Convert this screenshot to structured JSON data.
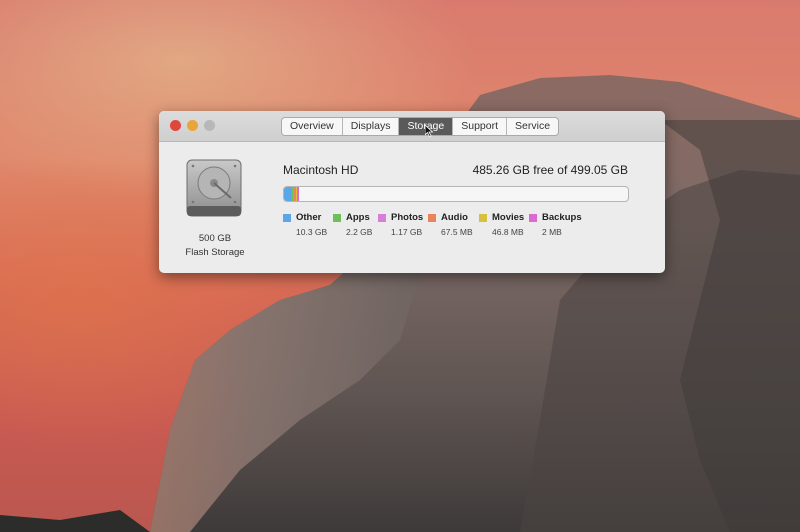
{
  "window": {
    "tabs": [
      {
        "label": "Overview"
      },
      {
        "label": "Displays"
      },
      {
        "label": "Storage",
        "active": true
      },
      {
        "label": "Support"
      },
      {
        "label": "Service"
      }
    ]
  },
  "disk": {
    "capacity_label": "500 GB",
    "type_label": "Flash Storage",
    "icon": "hard-drive-icon"
  },
  "volume": {
    "name": "Macintosh HD",
    "free_text": "485.26 GB free of 499.05 GB"
  },
  "usage": {
    "total_gb": 499.05,
    "categories": [
      {
        "name": "Other",
        "size": "10.3 GB",
        "gb": 10.3,
        "color": "#5aa7e8"
      },
      {
        "name": "Apps",
        "size": "2.2 GB",
        "gb": 2.2,
        "color": "#6cc05a"
      },
      {
        "name": "Photos",
        "size": "1.17 GB",
        "gb": 1.17,
        "color": "#d77ed8"
      },
      {
        "name": "Audio",
        "size": "67.5 MB",
        "gb": 0.0675,
        "color": "#e8835a"
      },
      {
        "name": "Movies",
        "size": "46.8 MB",
        "gb": 0.0468,
        "color": "#d6c03c"
      },
      {
        "name": "Backups",
        "size": "2 MB",
        "gb": 0.002,
        "color": "#d86ad0"
      }
    ]
  }
}
